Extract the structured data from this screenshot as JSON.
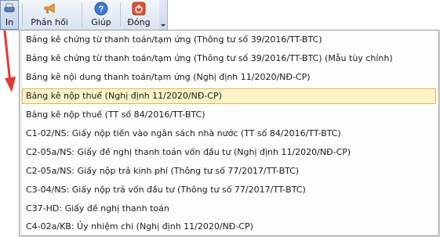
{
  "toolbar": {
    "in_label": "In",
    "feedback_label": "Phản hồi",
    "help_label": "Giúp",
    "close_label": "Đóng"
  },
  "menu": {
    "items": [
      "Bảng kê chứng từ thanh toán/tạm ứng (Thông tư số 39/2016/TT-BTC)",
      "Bảng kê chứng từ thanh toán/tạm ứng (Thông tư số 39/2016/TT-BTC) (Mẫu tùy chỉnh)",
      "Bảng kê nội dung thanh toán/tạm ứng (Nghị định 11/2020/NĐ-CP)",
      "Bảng kê nộp thuế (Nghị định 11/2020/NĐ-CP)",
      "Bảng kê nộp thuế (TT số 84/2016/TT-BTC)",
      "C1-02/NS: Giấy nộp tiền vào ngân sách nhà nước (TT số 84/2016/TT-BTC)",
      "C2-05a/NS: Giấy đề nghị thanh toán vốn đầu tư (Nghị định 11/2020/NĐ-CP)",
      "C2-05a/NS: Giấy nộp trả kinh phí (Thông tư số 77/2017/TT-BTC)",
      "C3-04/NS: Giấy nộp trả vốn đầu tư (Thông tư số 77/2017/TT-BTC)",
      "C37-HD: Giấy đề nghị thanh toán",
      "C4-02a/KB: Ủy nhiệm chi (Nghị định 11/2020/NĐ-CP)"
    ],
    "highlighted_index": 3
  },
  "colors": {
    "highlight_bg": "#fdf3c8",
    "highlight_border": "#e1b651",
    "arrow": "#e53935"
  }
}
